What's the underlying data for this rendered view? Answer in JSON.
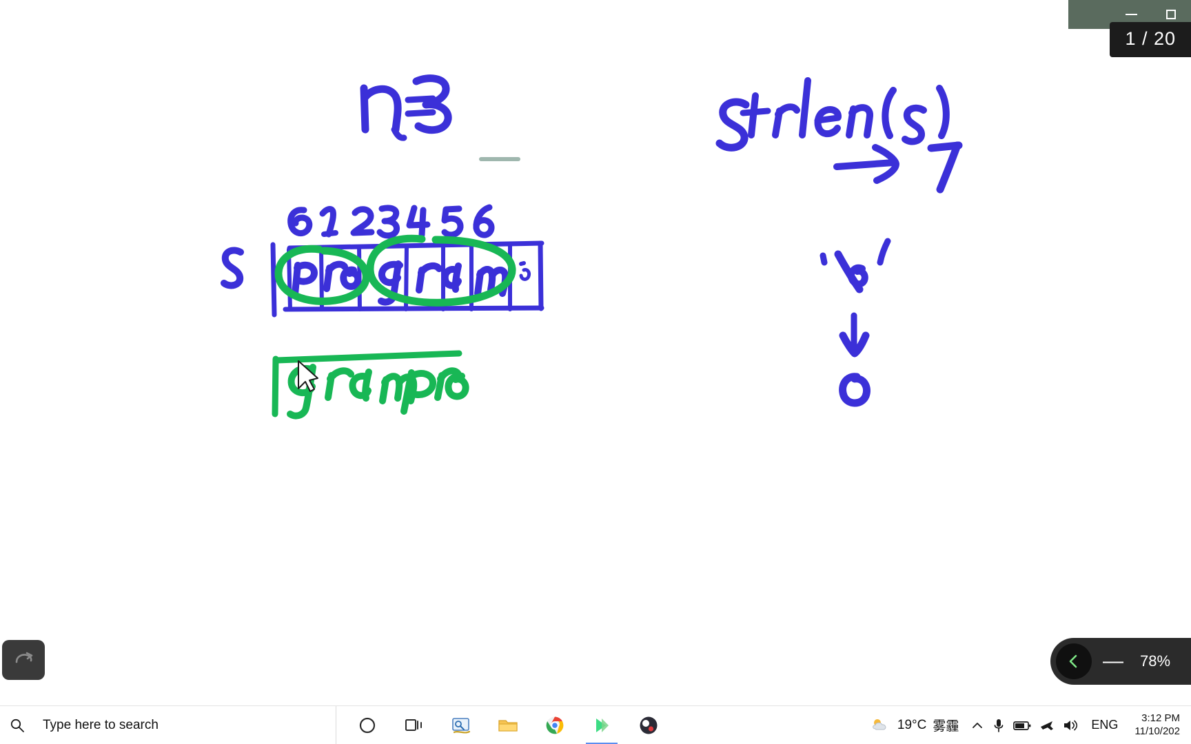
{
  "window": {
    "minimize_label": "Minimize",
    "maximize_label": "Restore",
    "slide_counter": "1 / 20"
  },
  "whiteboard": {
    "ink_blue": "#3b30d8",
    "ink_green": "#18b755",
    "annotations": {
      "n_equals": "n= 3",
      "var_name": "s",
      "indices": [
        "0",
        "1",
        "2",
        "3",
        "4",
        "5",
        "6"
      ],
      "cells": [
        "p",
        "r",
        "o",
        "g",
        "r",
        "a",
        "m"
      ],
      "strlen_call": "strlen(s)",
      "strlen_result": "7",
      "null_char": "'\\0'",
      "null_value": "0",
      "green_note": "gram pro"
    }
  },
  "toolbar": {
    "undo_label": "Undo",
    "zoom_collapse_label": "Collapse",
    "zoom_out_label": "Zoom out",
    "zoom_level": "78%"
  },
  "taskbar": {
    "search_placeholder": "Type here to search",
    "items": [
      {
        "name": "cortana",
        "label": "Cortana"
      },
      {
        "name": "task-view",
        "label": "Task View"
      },
      {
        "name": "snip-sketch",
        "label": "Snip & Sketch"
      },
      {
        "name": "file-explorer",
        "label": "File Explorer"
      },
      {
        "name": "google-chrome",
        "label": "Google Chrome"
      },
      {
        "name": "whiteboard",
        "label": "Microsoft Whiteboard"
      },
      {
        "name": "obs-studio",
        "label": "OBS Studio"
      }
    ],
    "tray": {
      "temperature": "19°C",
      "condition": "雾霾",
      "language": "ENG",
      "time": "3:12 PM",
      "date": "11/10/202"
    }
  }
}
